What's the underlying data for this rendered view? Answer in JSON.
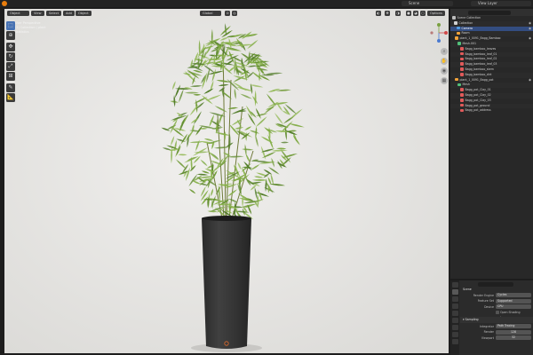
{
  "topbar": {
    "scene_label": "Scene",
    "view_layer_label": "View Layer"
  },
  "viewport": {
    "mode_label": "Object Mode",
    "view_menu": "View",
    "select_menu": "Select",
    "add_menu": "Add",
    "object_menu": "Object",
    "transform_label": "Global",
    "options_label": "Options",
    "info_lines": [
      "User Perspective",
      "(1) Collection | plant",
      "Statistics"
    ]
  },
  "outliner": {
    "rows": [
      {
        "label": "Scene Collection",
        "indent": 2,
        "icon_color": "#bdbdbd",
        "selected": false,
        "eye": false
      },
      {
        "label": "Collection",
        "indent": 4,
        "icon_color": "#d0d0d0",
        "selected": false,
        "eye": true
      },
      {
        "label": "Camera",
        "indent": 7,
        "icon_color": "#4f9be0",
        "selected": true,
        "eye": true
      },
      {
        "label": "Room",
        "indent": 7,
        "icon_color": "#f2a33a",
        "selected": false,
        "eye": false
      },
      {
        "label": "plant_1_0091_Bagg_Bamboo",
        "indent": 5,
        "icon_color": "#f2a33a",
        "selected": false,
        "eye": true
      },
      {
        "label": "Mesh.001",
        "indent": 8,
        "icon_color": "#52c07a",
        "selected": false,
        "eye": false
      },
      {
        "label": "Bagg_bamboo_leaves",
        "indent": 11,
        "icon_color": "#e05a5a",
        "selected": false,
        "eye": false
      },
      {
        "label": "Bagg_bamboo_leaf_01",
        "indent": 11,
        "icon_color": "#e05a5a",
        "selected": false,
        "eye": false
      },
      {
        "label": "Bagg_bamboo_leaf_02",
        "indent": 11,
        "icon_color": "#e05a5a",
        "selected": false,
        "eye": false
      },
      {
        "label": "Bagg_bamboo_leaf_03",
        "indent": 11,
        "icon_color": "#e05a5a",
        "selected": false,
        "eye": false
      },
      {
        "label": "Bagg_bamboo_stem",
        "indent": 11,
        "icon_color": "#e05a5a",
        "selected": false,
        "eye": false
      },
      {
        "label": "Bagg_bamboo_dirt",
        "indent": 11,
        "icon_color": "#e05a5a",
        "selected": false,
        "eye": false
      },
      {
        "label": "plant_1_0091_Bagg_pot",
        "indent": 5,
        "icon_color": "#f2a33a",
        "selected": false,
        "eye": true
      },
      {
        "label": "Mesh",
        "indent": 8,
        "icon_color": "#52c07a",
        "selected": false,
        "eye": false
      },
      {
        "label": "Bagg_pot_Clay_01",
        "indent": 11,
        "icon_color": "#e05a5a",
        "selected": false,
        "eye": false
      },
      {
        "label": "Bagg_pot_Clay_02",
        "indent": 11,
        "icon_color": "#e05a5a",
        "selected": false,
        "eye": false
      },
      {
        "label": "Bagg_pot_Clay_03",
        "indent": 11,
        "icon_color": "#e05a5a",
        "selected": false,
        "eye": false
      },
      {
        "label": "Bagg_pot_ground",
        "indent": 11,
        "icon_color": "#e05a5a",
        "selected": false,
        "eye": false
      },
      {
        "label": "Bagg_pot_address",
        "indent": 11,
        "icon_color": "#e05a5a",
        "selected": false,
        "eye": false
      }
    ]
  },
  "properties": {
    "section_title": "Scene",
    "render_engine_label": "Render Engine",
    "render_engine_value": "Cycles",
    "feature_set_label": "Feature Set",
    "feature_set_value": "Supported",
    "device_label": "Device",
    "device_value": "CPU",
    "osl_label": "Open Shading Language",
    "sampling_title": "Sampling",
    "integrator_label": "Integrator",
    "integrator_value": "Path Tracing",
    "render_label": "Render",
    "render_value": "128",
    "viewport_label": "Viewport",
    "viewport_value": "32"
  }
}
